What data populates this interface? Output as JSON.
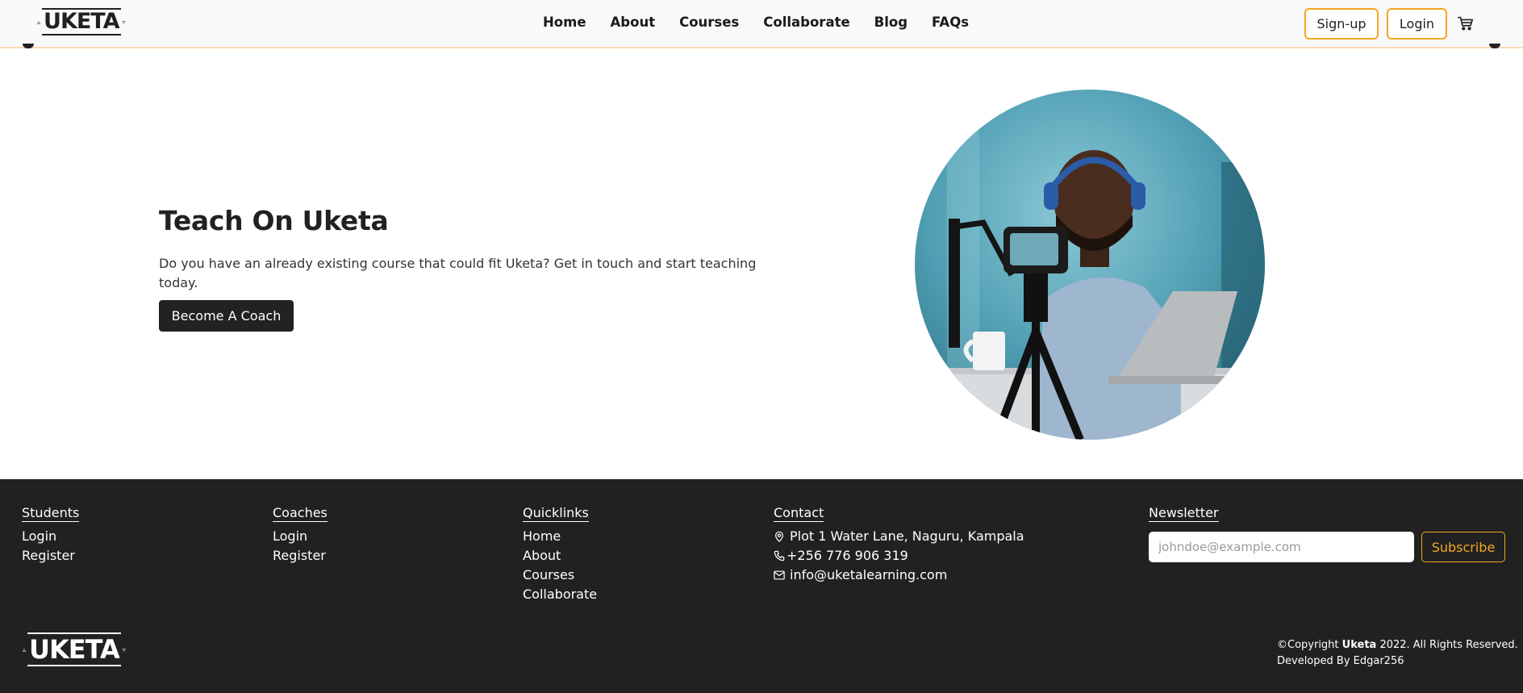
{
  "header": {
    "logo_text": "UKETA",
    "nav": [
      "Home",
      "About",
      "Courses",
      "Collaborate",
      "Blog",
      "FAQs"
    ],
    "signup_label": "Sign-up",
    "login_label": "Login",
    "cart_icon": "cart-icon"
  },
  "hero": {
    "title": "Teach On Uketa",
    "description": "Do you have an already existing course that could fit Uketa? Get in touch and start teaching today.",
    "cta_label": "Become A Coach",
    "image_alt": "Man with headphones recording a video lesson with a camera on a tripod"
  },
  "footer": {
    "students": {
      "heading": "Students",
      "links": [
        "Login",
        "Register"
      ]
    },
    "coaches": {
      "heading": "Coaches",
      "links": [
        "Login",
        "Register"
      ]
    },
    "quicklinks": {
      "heading": "Quicklinks",
      "links": [
        "Home",
        "About",
        "Courses",
        "Collaborate"
      ]
    },
    "contact": {
      "heading": "Contact",
      "address": "Plot 1 Water Lane, Naguru, Kampala",
      "phone": "+256 776 906 319",
      "email": "info@uketalearning.com"
    },
    "newsletter": {
      "heading": "Newsletter",
      "placeholder": "johndoe@example.com",
      "value": "",
      "subscribe_label": "Subscribe"
    },
    "logo_text": "UKETA",
    "copyright_prefix": "©Copyright ",
    "copyright_brand": "Uketa",
    "copyright_suffix": " 2022. All Rights Reserved.",
    "developer": "Developed By Edgar256"
  },
  "colors": {
    "accent": "#f5a623",
    "dark": "#212121",
    "header_bg": "#f8f9fa"
  }
}
